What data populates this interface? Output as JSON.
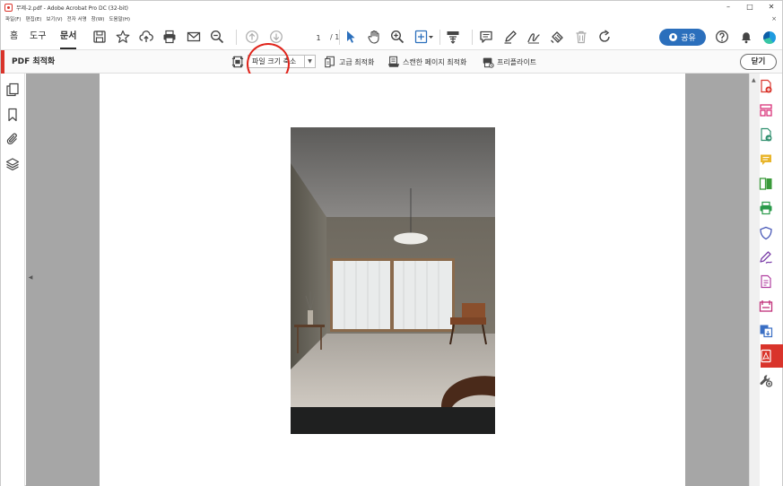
{
  "window": {
    "title": "무제-2.pdf - Adobe Acrobat Pro DC (32-bit)",
    "minimize_label": "–",
    "maximize_label": "□",
    "close_label": "✕"
  },
  "menubar": {
    "items": [
      "파일(F)",
      "편집(E)",
      "보기(V)",
      "전자 서명",
      "창(W)",
      "도움말(H)"
    ],
    "close_glyph": "×"
  },
  "toolbar": {
    "tabs": [
      "홈",
      "도구",
      "문서"
    ],
    "active_tab": "문서",
    "page_current": "1",
    "page_total": "/ 1",
    "share_label": "공유"
  },
  "optimize": {
    "title": "PDF 최적화",
    "reduce_size_label": "파일 크기 축소",
    "advanced_label": "고급 최적화",
    "scanned_label": "스캔한 페이지 최적화",
    "preflight_label": "프리플라이트",
    "close_label": "닫기"
  },
  "colors": {
    "accent_red": "#d9342b",
    "share_blue": "#2b6fbc",
    "annotation_red": "#e0241b",
    "doc_background": "#a6a6a6"
  },
  "icons": {
    "toolbar": [
      "save-icon",
      "bookmark-star-icon",
      "upload-cloud-icon",
      "print-icon",
      "email-icon",
      "zoom-out-icon",
      "page-up-icon",
      "page-down-icon",
      "select-cursor-icon",
      "hand-icon",
      "zoom-in-icon",
      "zoom-dropdown-icon",
      "scroll-mode-icon",
      "comment-icon",
      "highlight-pen-icon",
      "sign-icon",
      "stamp-icon",
      "trash-icon",
      "rotate-icon",
      "help-icon",
      "bell-icon"
    ],
    "left_nav": [
      "pages-icon",
      "bookmarks-icon",
      "attachments-icon",
      "layers-icon"
    ],
    "right_pane": [
      "create-pdf-icon",
      "organize-pages-icon",
      "export-pdf-icon",
      "comment-tool-icon",
      "combine-files-icon",
      "print-production-icon",
      "protect-icon",
      "fill-sign-icon",
      "edit-pdf-icon",
      "compare-icon",
      "send-for-review-icon",
      "optimize-pdf-icon",
      "more-tools-icon"
    ]
  }
}
